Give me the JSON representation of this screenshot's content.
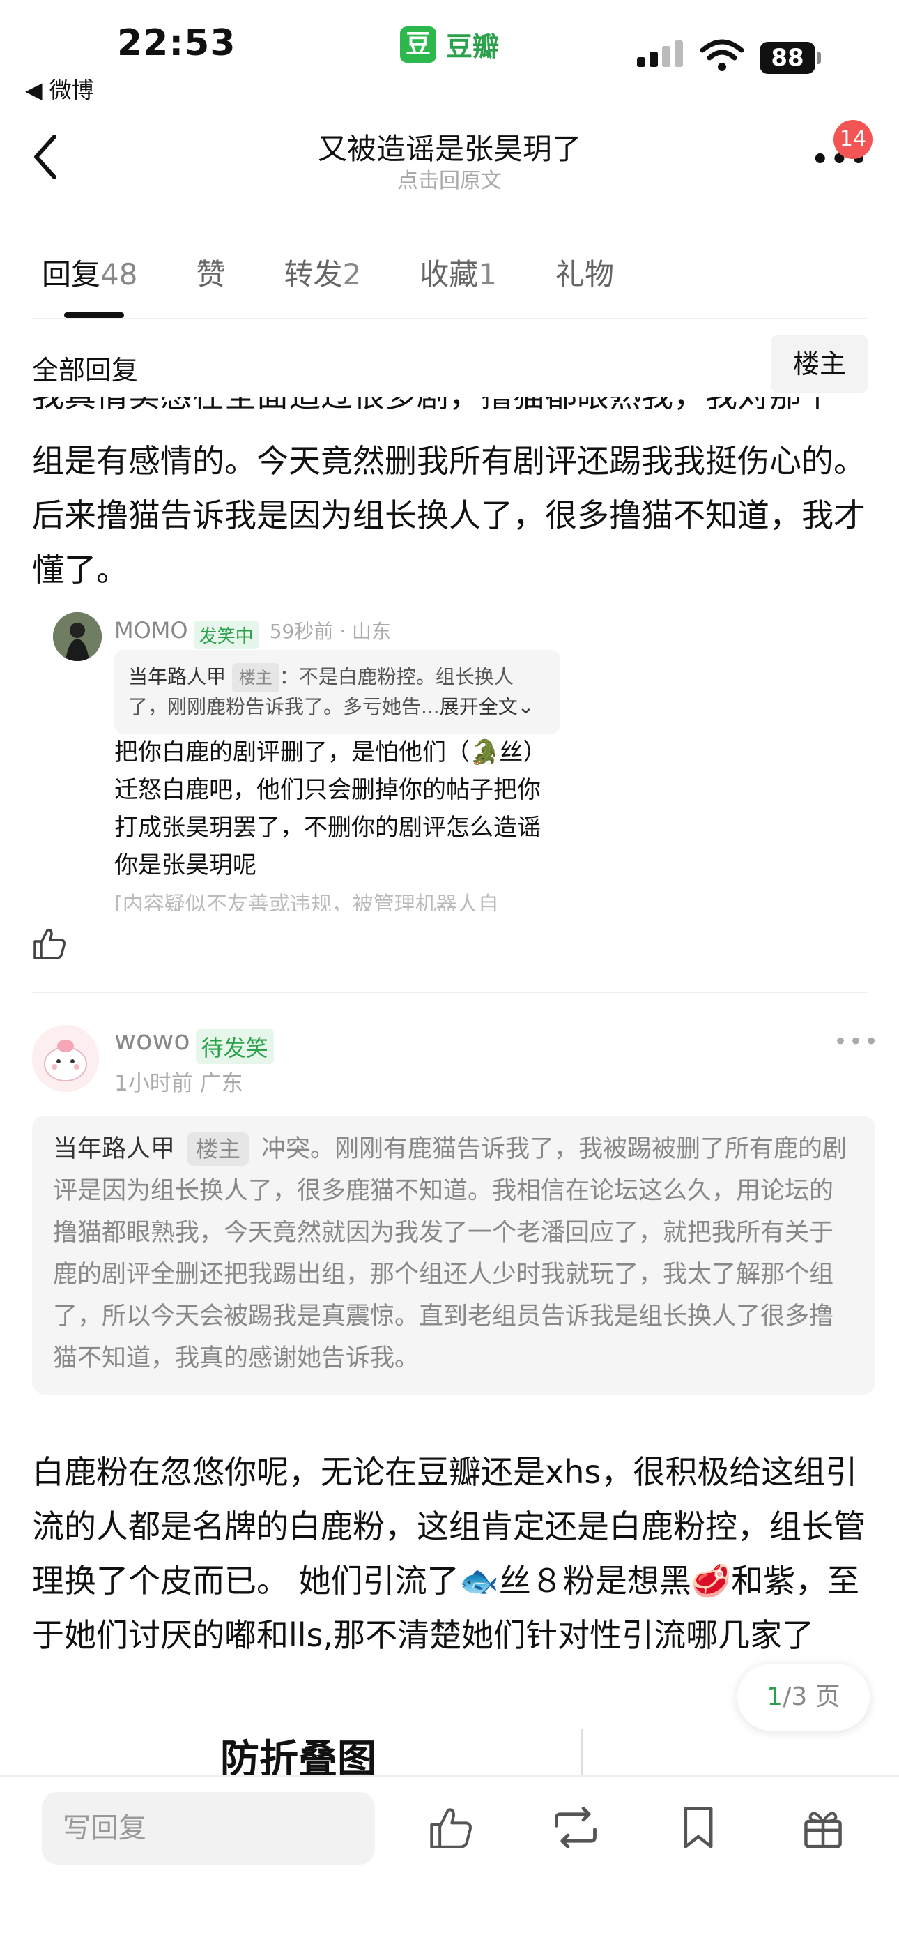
{
  "status_bar": {
    "time": "22:53",
    "back_app": "◀ 微博",
    "battery": "88"
  },
  "brand": {
    "logo_char": "豆",
    "name": "豆瓣"
  },
  "header": {
    "title": "又被造谣是张昊玥了",
    "subtitle": "点击回原文",
    "more": "•••",
    "badge": "14"
  },
  "tabs": [
    {
      "label": "回复",
      "count": "48"
    },
    {
      "label": "赞",
      "count": ""
    },
    {
      "label": "转发",
      "count": "2"
    },
    {
      "label": "收藏",
      "count": "1"
    },
    {
      "label": "礼物",
      "count": ""
    }
  ],
  "filter": {
    "all_label": "全部回复",
    "op_label": "楼主"
  },
  "post": {
    "clipped_line": "我真情实感在全面追过很多剧，撸猫都眼熟我，我对那个",
    "paragraph": "组是有感情的。今天竟然删我所有剧评还踢我我挺伤心的。后来撸猫告诉我是因为组长换人了，很多撸猫不知道，我才懂了。"
  },
  "reply1": {
    "name": "MOMO",
    "tag": "发笑中",
    "meta": "59秒前 · 山东",
    "quote_name": "当年路人甲",
    "quote_tag": "楼主",
    "quote_text": "：不是白鹿粉控。组长换人了，刚刚鹿粉告诉我了。多亏她告...",
    "expand": "展开全文",
    "text": "把你白鹿的剧评删了，是怕他们（🐊丝）迁怒白鹿吧，他们只会删掉你的帖子把你打成张昊玥罢了，不删你的剧评怎么造谣你是张昊玥呢",
    "faded": "[内容疑似不友善或违规，被管理机器人自"
  },
  "reply2": {
    "name": "wowo",
    "tag": "待发笑",
    "meta": "1小时前 广东",
    "more": "•••",
    "quote_name": "当年路人甲",
    "quote_tag": "楼主",
    "quote_text": "冲突。刚刚有鹿猫告诉我了，我被踢被删了所有鹿的剧评是因为组长换人了，很多鹿猫不知道。我相信在论坛这么久，用论坛的撸猫都眼熟我，今天竟然就因为我发了一个老潘回应了，就把我所有关于鹿的剧评全删还把我踢出组，那个组还人少时我就玩了，我太了解那个组了，所以今天会被踢我是真震惊。直到老组员告诉我是组长换人了很多撸猫不知道，我真的感谢她告诉我。",
    "text": "白鹿粉在忽悠你呢，无论在豆瓣还是xhs，很积极给这组引流的人都是名牌的白鹿粉，这组肯定还是白鹿粉控，组长管理换了个皮而已。 她们引流了🐟丝８粉是想黑🥩和紫，至于她们讨厌的嘟和lls,那不清楚她们针对性引流哪几家了"
  },
  "pager": {
    "current": "1",
    "total": "/3 页"
  },
  "fold_image_text": "防折叠图",
  "bottom": {
    "reply_placeholder": "写回复"
  }
}
